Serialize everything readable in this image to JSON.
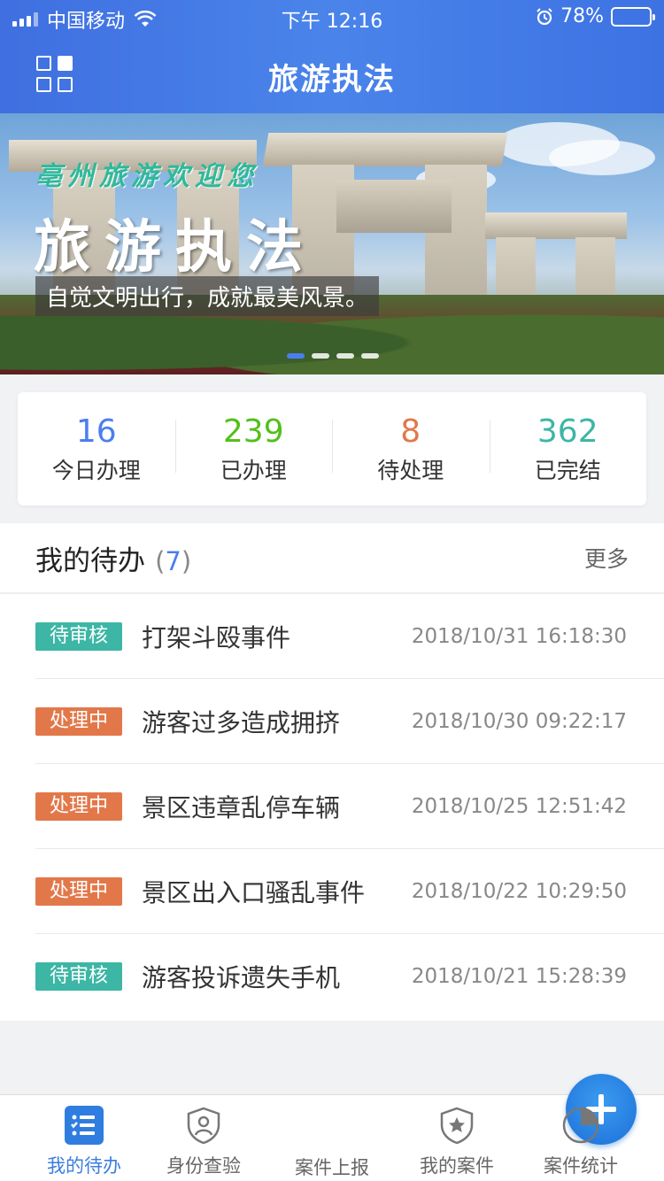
{
  "status_bar": {
    "carrier": "中国移动",
    "time": "下午 12:16",
    "battery_text": "78%",
    "battery_level": 0.78
  },
  "nav": {
    "title": "旅游执法",
    "menu_icon": "grid-icon"
  },
  "banner": {
    "welcome": "亳州旅游欢迎您",
    "title": "旅游执法",
    "slogan": "自觉文明出行，成就最美风景。",
    "page_count": 4,
    "active_page": 1
  },
  "stats": [
    {
      "value": "16",
      "label": "今日办理",
      "color": "#4a7ef0"
    },
    {
      "value": "239",
      "label": "已办理",
      "color": "#52c01a"
    },
    {
      "value": "8",
      "label": "待处理",
      "color": "#e2784a"
    },
    {
      "value": "362",
      "label": "已完结",
      "color": "#3db6a5"
    }
  ],
  "todo": {
    "title": "我的待办",
    "count_open": "(",
    "count": "7",
    "count_close": ")",
    "more": "更多",
    "items": [
      {
        "status": "待审核",
        "status_type": "review",
        "name": "打架斗殴事件",
        "time": "2018/10/31 16:18:30"
      },
      {
        "status": "处理中",
        "status_type": "processing",
        "name": "游客过多造成拥挤",
        "time": "2018/10/30 09:22:17"
      },
      {
        "status": "处理中",
        "status_type": "processing",
        "name": "景区违章乱停车辆",
        "time": "2018/10/25 12:51:42"
      },
      {
        "status": "处理中",
        "status_type": "processing",
        "name": "景区出入口骚乱事件",
        "time": "2018/10/22 10:29:50"
      },
      {
        "status": "待审核",
        "status_type": "review",
        "name": "游客投诉遗失手机",
        "time": "2018/10/21 15:28:39"
      }
    ]
  },
  "tabbar": {
    "tabs": [
      {
        "label": "我的待办",
        "icon": "task-list-icon",
        "active": true
      },
      {
        "label": "身份查验",
        "icon": "identity-shield-icon",
        "active": false
      },
      {
        "label": "案件上报",
        "icon": "plus-icon",
        "active": false
      },
      {
        "label": "我的案件",
        "icon": "star-shield-icon",
        "active": false
      },
      {
        "label": "案件统计",
        "icon": "pie-chart-icon",
        "active": false
      }
    ]
  },
  "colors": {
    "accent": "#3c7de0",
    "header": "#4a84ea"
  }
}
